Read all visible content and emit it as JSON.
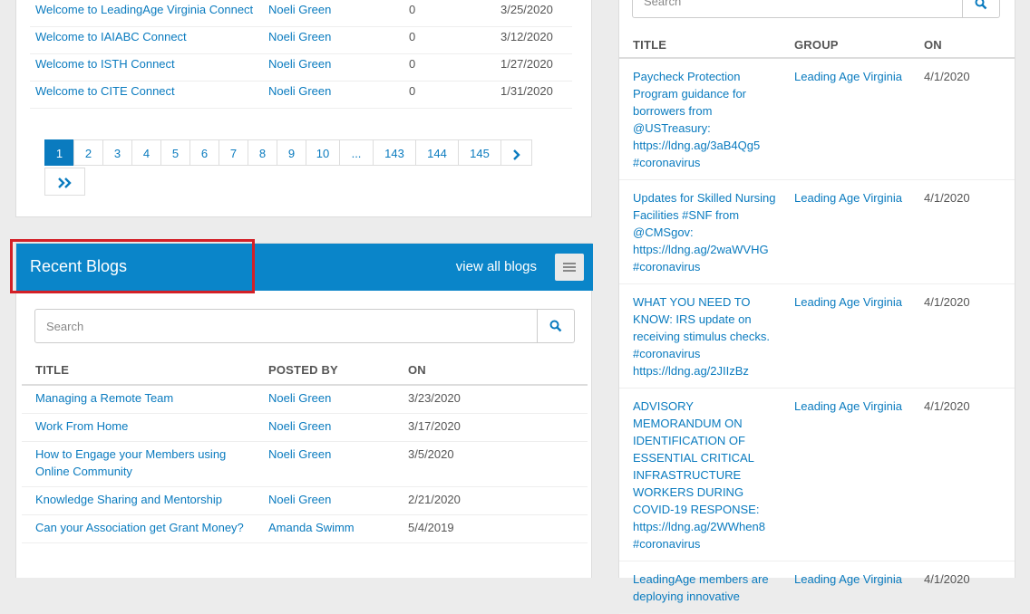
{
  "discussions": {
    "rows": [
      {
        "title": "Welcome to LeadingAge Virginia Connect",
        "author": "Noeli Green",
        "replies": "0",
        "date": "3/25/2020"
      },
      {
        "title": "Welcome to IAIABC Connect",
        "author": "Noeli Green",
        "replies": "0",
        "date": "3/12/2020"
      },
      {
        "title": "Welcome to ISTH Connect",
        "author": "Noeli Green",
        "replies": "0",
        "date": "1/27/2020"
      },
      {
        "title": "Welcome to CITE Connect",
        "author": "Noeli Green",
        "replies": "0",
        "date": "1/31/2020"
      }
    ]
  },
  "pagination": {
    "pages": [
      "1",
      "2",
      "3",
      "4",
      "5",
      "6",
      "7",
      "8",
      "9",
      "10",
      "...",
      "143",
      "144",
      "145"
    ],
    "active": "1",
    "next_icon": "chevron-right-icon",
    "last_icon": "double-chevron-right-icon"
  },
  "blogs": {
    "title": "Recent Blogs",
    "view_all": "view all blogs",
    "menu_icon": "hamburger-menu-icon",
    "search_placeholder": "Search",
    "headers": {
      "title": "TITLE",
      "posted_by": "POSTED BY",
      "on": "ON"
    },
    "rows": [
      {
        "title": "Managing a Remote Team",
        "author": "Noeli Green",
        "date": "3/23/2020"
      },
      {
        "title": "Work From Home",
        "author": "Noeli Green",
        "date": "3/17/2020"
      },
      {
        "title": "How to Engage your Members using Online Community",
        "author": "Noeli Green",
        "date": "3/5/2020"
      },
      {
        "title": "Knowledge Sharing and Mentorship",
        "author": "Noeli Green",
        "date": "2/21/2020"
      },
      {
        "title": "Can your Association get Grant Money?",
        "author": "Amanda Swimm",
        "date": "5/4/2019"
      }
    ]
  },
  "posts": {
    "search_placeholder": "Search",
    "headers": {
      "title": "TITLE",
      "group": "GROUP",
      "on": "ON"
    },
    "rows": [
      {
        "title": "Paycheck Protection Program guidance for borrowers from @USTreasury: https://ldng.ag/3aB4Qg5 #coronavirus",
        "group": "Leading Age Virginia",
        "date": "4/1/2020"
      },
      {
        "title": "Updates for Skilled Nursing Facilities #SNF from @CMSgov: https://ldng.ag/2waWVHG #coronavirus",
        "group": "Leading Age Virginia",
        "date": "4/1/2020"
      },
      {
        "title": "WHAT YOU NEED TO KNOW: IRS update on receiving stimulus checks. #coronavirus https://ldng.ag/2JIIzBz",
        "group": "Leading Age Virginia",
        "date": "4/1/2020"
      },
      {
        "title": "ADVISORY MEMORANDUM ON IDENTIFICATION OF ESSENTIAL CRITICAL INFRASTRUCTURE WORKERS DURING COVID-19 RESPONSE: https://ldng.ag/2WWhen8 #coronavirus",
        "group": "Leading Age Virginia",
        "date": "4/1/2020"
      },
      {
        "title": "LeadingAge members are deploying innovative",
        "group": "Leading Age Virginia",
        "date": "4/1/2020"
      }
    ]
  },
  "colors": {
    "accent": "#0a85c9",
    "link": "#0a7bbf",
    "highlight": "#d32027"
  }
}
